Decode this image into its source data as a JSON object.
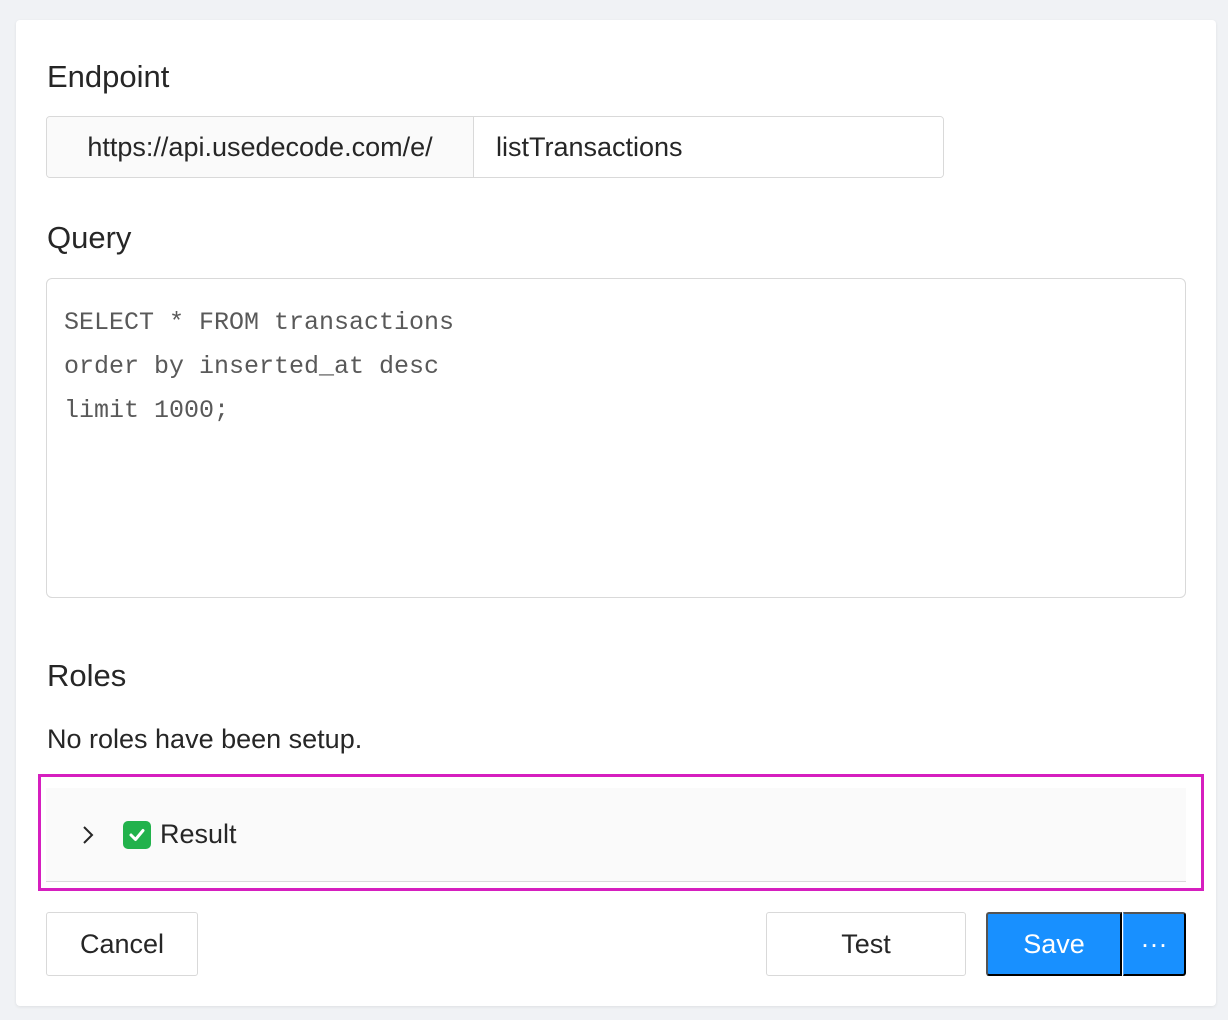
{
  "endpoint": {
    "title": "Endpoint",
    "prefix": "https://api.usedecode.com/e/",
    "path_value": "listTransactions"
  },
  "query": {
    "title": "Query",
    "sql": "SELECT * FROM transactions\norder by inserted_at desc\nlimit 1000;"
  },
  "roles": {
    "title": "Roles",
    "empty_message": "No roles have been setup."
  },
  "result": {
    "status_icon": "check-mark-icon",
    "status_color": "#22b24c",
    "label": "Result",
    "expanded": false
  },
  "footer": {
    "cancel_label": "Cancel",
    "test_label": "Test",
    "save_label": "Save",
    "more_label": "···"
  },
  "colors": {
    "primary": "#1890ff",
    "highlight": "#d61fbf"
  }
}
